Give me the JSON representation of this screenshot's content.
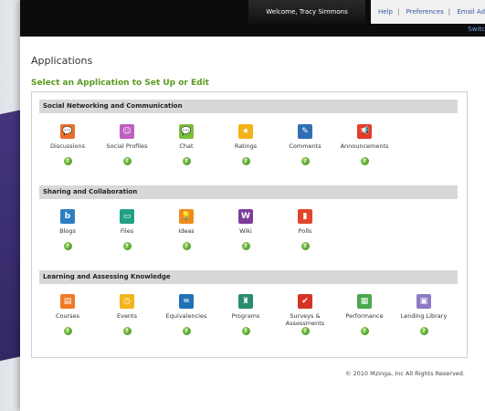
{
  "header": {
    "welcome": "Welcome, Tracy Simmons",
    "links": [
      "Help",
      "Preferences",
      "Email Ad"
    ],
    "switch": "Switc"
  },
  "page": {
    "title": "Applications",
    "subtitle": "Select an Application to Set Up or Edit"
  },
  "help_glyph": "?",
  "sections": [
    {
      "title": "Social Networking and Communication",
      "apps": [
        {
          "label": "Discussions",
          "icon": "discussions-icon",
          "color": "#e8712a",
          "glyph": "💬"
        },
        {
          "label": "Social Profiles",
          "icon": "social-profiles-icon",
          "color": "#c05fc0",
          "glyph": "☺"
        },
        {
          "label": "Chat",
          "icon": "chat-icon",
          "color": "#7bbf3a",
          "glyph": "💬"
        },
        {
          "label": "Ratings",
          "icon": "ratings-icon",
          "color": "#f2b316",
          "glyph": "★"
        },
        {
          "label": "Comments",
          "icon": "comments-icon",
          "color": "#2f6fb3",
          "glyph": "✎"
        },
        {
          "label": "Announcements",
          "icon": "announcements-icon",
          "color": "#e23c2a",
          "glyph": "📢"
        }
      ]
    },
    {
      "title": "Sharing and Collaboration",
      "apps": [
        {
          "label": "Blogs",
          "icon": "blogs-icon",
          "color": "#2d7fc1",
          "glyph": "b"
        },
        {
          "label": "Files",
          "icon": "files-icon",
          "color": "#22a085",
          "glyph": "▭"
        },
        {
          "label": "Ideas",
          "icon": "ideas-icon",
          "color": "#ef8b1d",
          "glyph": "💡"
        },
        {
          "label": "Wiki",
          "icon": "wiki-icon",
          "color": "#7c3d9b",
          "glyph": "W"
        },
        {
          "label": "Polls",
          "icon": "polls-icon",
          "color": "#e2462c",
          "glyph": "▮"
        }
      ]
    },
    {
      "title": "Learning and Assessing Knowledge",
      "apps": [
        {
          "label": "Courses",
          "icon": "courses-icon",
          "color": "#ef7a26",
          "glyph": "▤"
        },
        {
          "label": "Events",
          "icon": "events-icon",
          "color": "#f3b31b",
          "glyph": "◷"
        },
        {
          "label": "Equivalencies",
          "icon": "equivalencies-icon",
          "color": "#1f72b8",
          "glyph": "="
        },
        {
          "label": "Programs",
          "icon": "programs-icon",
          "color": "#2a8c6f",
          "glyph": "♜"
        },
        {
          "label": "Surveys & Assessments",
          "icon": "surveys-icon",
          "color": "#d63327",
          "glyph": "✔"
        },
        {
          "label": "Performance",
          "icon": "performance-icon",
          "color": "#4aa84a",
          "glyph": "▦"
        },
        {
          "label": "Lending Library",
          "icon": "lending-library-icon",
          "color": "#8d7ac5",
          "glyph": "▣"
        }
      ]
    }
  ],
  "footer": "© 2010 Mzinga, Inc All Rights Reserved."
}
